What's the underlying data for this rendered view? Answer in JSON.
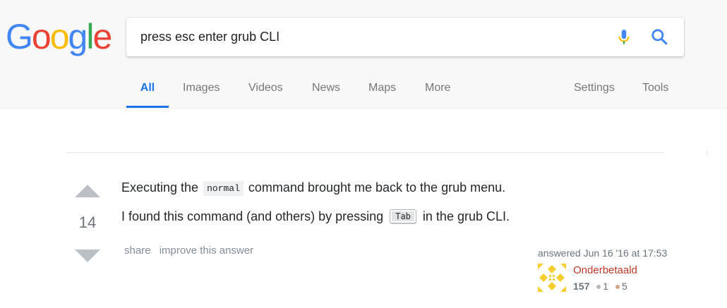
{
  "google": {
    "logo_letters": [
      {
        "ch": "G",
        "color": "#4285F4"
      },
      {
        "ch": "o",
        "color": "#EA4335"
      },
      {
        "ch": "o",
        "color": "#FBBC05"
      },
      {
        "ch": "g",
        "color": "#4285F4"
      },
      {
        "ch": "l",
        "color": "#34A853"
      },
      {
        "ch": "e",
        "color": "#EA4335"
      }
    ],
    "search": {
      "query": "press esc enter grub CLI"
    },
    "tabs": [
      "All",
      "Images",
      "Videos",
      "News",
      "Maps",
      "More",
      "Settings",
      "Tools"
    ],
    "active_tab": "All",
    "accent_color": "#1a73e8"
  },
  "answer": {
    "votes": "14",
    "para1": {
      "before": "Executing the",
      "code": "normal",
      "after": "command brought me back to the grub menu."
    },
    "para2": {
      "before": "I found this command (and others) by pressing",
      "kbd": "Tab",
      "after": "in the grub CLI."
    },
    "menu": {
      "share": "share",
      "improve": "improve this answer"
    },
    "user": {
      "answered": "answered Jun 16 '16 at 17:53",
      "name": "Onderbetaald",
      "reputation": "157",
      "silver": "1",
      "bronze": "5",
      "silver_color": "#b4b8bc",
      "bronze_color": "#d1a684",
      "name_color": "#c0392b"
    }
  }
}
